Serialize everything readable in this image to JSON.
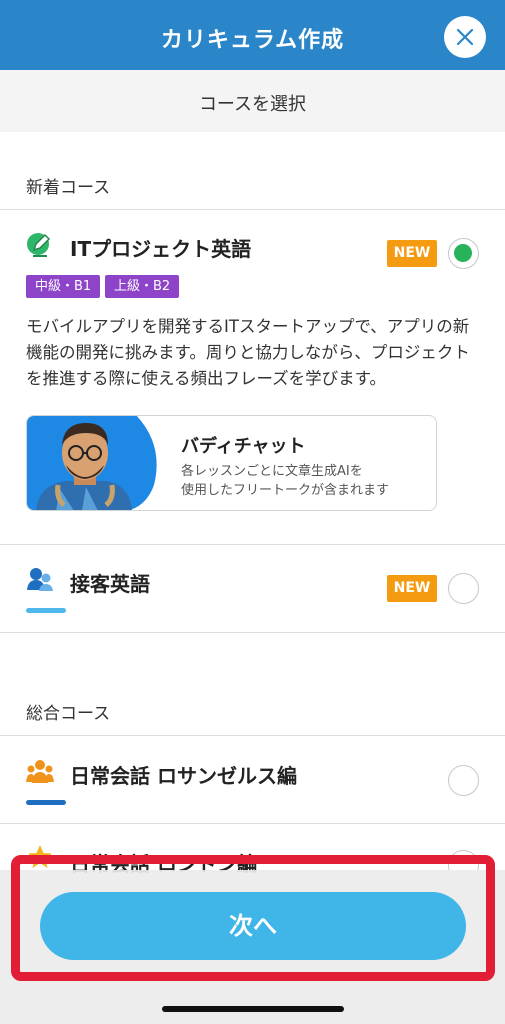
{
  "header": {
    "title": "カリキュラム作成"
  },
  "subheader": {
    "title": "コースを選択"
  },
  "sections": {
    "new": {
      "title": "新着コース"
    },
    "general": {
      "title": "総合コース"
    }
  },
  "courses": [
    {
      "name": "ITプロジェクト英語",
      "badge": "NEW",
      "selected": true,
      "levels": [
        "中級・B1",
        "上級・B2"
      ],
      "description": "モバイルアプリを開発するITスタートアップで、アプリの新機能の開発に挑みます。周りと協力しながら、プロジェクトを推進する際に使える頻出フレーズを学びます。",
      "buddy": {
        "title": "バディチャット",
        "desc_line1": "各レッスンごとに文章生成AIを",
        "desc_line2": "使用したフリートークが含まれます"
      }
    },
    {
      "name": "接客英語",
      "badge": "NEW",
      "selected": false
    },
    {
      "name": "日常会話 ロサンゼルス編",
      "selected": false
    },
    {
      "name": "日常会話 ロンドン編",
      "selected": false
    }
  ],
  "footer": {
    "next_label": "次へ"
  },
  "colors": {
    "header": "#2b86c9",
    "accent_button": "#3fb5e8",
    "badge": "#f59b12",
    "level_tag": "#8e44c9",
    "selected": "#27b35a",
    "highlight": "#e21d36"
  }
}
